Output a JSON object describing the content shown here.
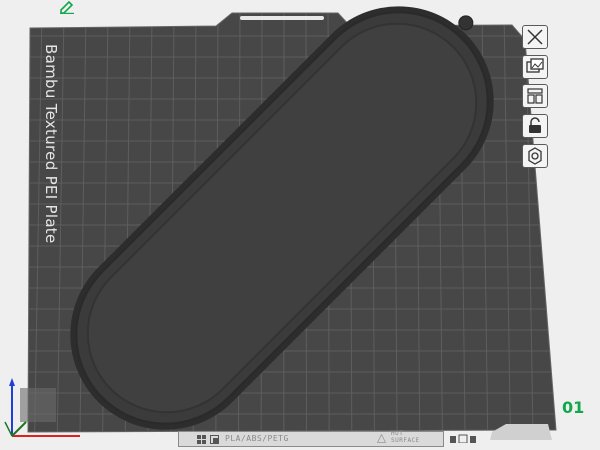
{
  "plate": {
    "brand_label": "Bambu Textured PEI Plate",
    "number": "01",
    "filament_types": "PLA/ABS/PETG",
    "surface_note_line1": "HOT",
    "surface_note_line2": "SURFACE"
  },
  "toolbar": {
    "buttons": [
      {
        "name": "close-button",
        "icon": "close-icon"
      },
      {
        "name": "pick-image-button",
        "icon": "image-icon"
      },
      {
        "name": "arrange-button",
        "icon": "arrange-icon"
      },
      {
        "name": "lock-button",
        "icon": "lock-icon"
      },
      {
        "name": "settings-button",
        "icon": "gear-icon"
      }
    ]
  },
  "colors": {
    "bed": "#474747",
    "grid": "#5f5f5f",
    "model": "#3a3a3a",
    "accent_green": "#11a84a"
  },
  "axes": {
    "x_color": "#e02020",
    "y_color": "#1a7a1a",
    "z_color": "#1f3fd6"
  }
}
